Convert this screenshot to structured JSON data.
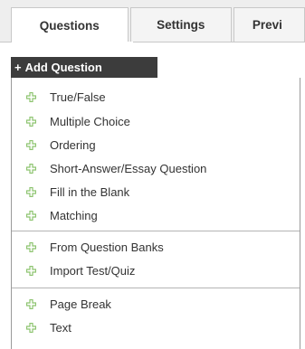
{
  "tabs": [
    {
      "label": "Questions",
      "active": true
    },
    {
      "label": "Settings",
      "active": false
    },
    {
      "label": "Previ",
      "active": false
    }
  ],
  "add_button": {
    "plus": "+",
    "label": "Add Question"
  },
  "menu": {
    "question_types": [
      "True/False",
      "Multiple Choice",
      "Ordering",
      "Short-Answer/Essay Question",
      "Fill in the Blank",
      "Matching"
    ],
    "sources": [
      "From Question Banks",
      "Import Test/Quiz"
    ],
    "other": [
      "Page Break",
      "Text"
    ]
  },
  "icon": "green-plus-icon",
  "colors": {
    "icon_green": "#8cc36e",
    "button_bg": "#3c3c3c",
    "tab_bg": "#eeeeee"
  }
}
